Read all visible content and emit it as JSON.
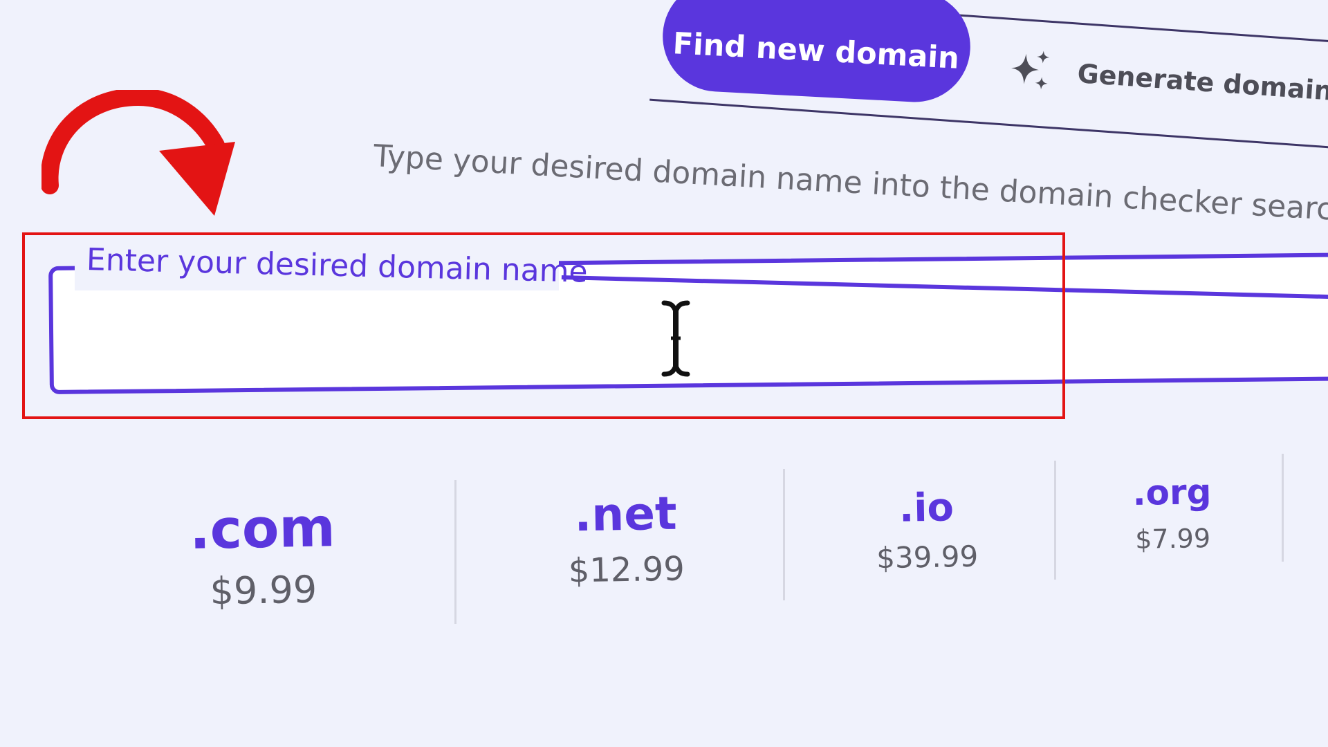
{
  "tabs": {
    "find_label": "Find new domain",
    "ai_label": "Generate domain using AI",
    "ai_icon": "sparkle-icon"
  },
  "description": "Type your desired domain name into the domain checker search bar and find out",
  "search": {
    "label": "Enter your desired domain name",
    "value": ""
  },
  "annotation": {
    "arrow_color": "#e31414",
    "box_color": "#e31414"
  },
  "tlds": [
    {
      "name": ".com",
      "price": "$9.99"
    },
    {
      "name": ".net",
      "price": "$12.99"
    },
    {
      "name": ".io",
      "price": "$39.99"
    },
    {
      "name": ".org",
      "price": "$7.99"
    }
  ],
  "colors": {
    "brand": "#5a36dd",
    "background": "#f0f2fc",
    "annotation": "#e31414"
  }
}
